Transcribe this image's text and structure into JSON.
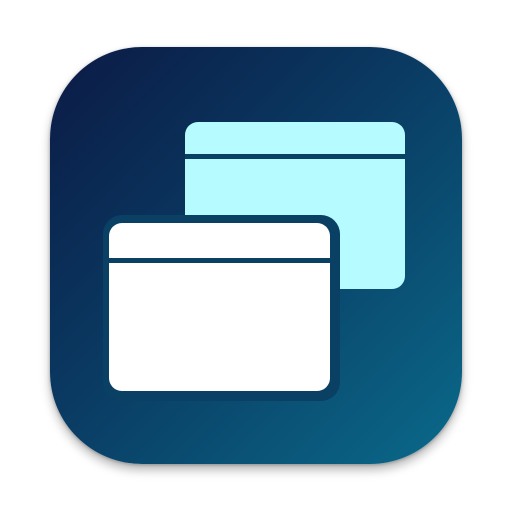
{
  "icon": {
    "name": "window-stack-icon",
    "description_kind": "app-icon",
    "colors": {
      "background_start": "#0b1a45",
      "background_end": "#0a6a8a",
      "back_window": "#b6fbff",
      "front_window": "#ffffff",
      "divider": "#094063"
    }
  }
}
